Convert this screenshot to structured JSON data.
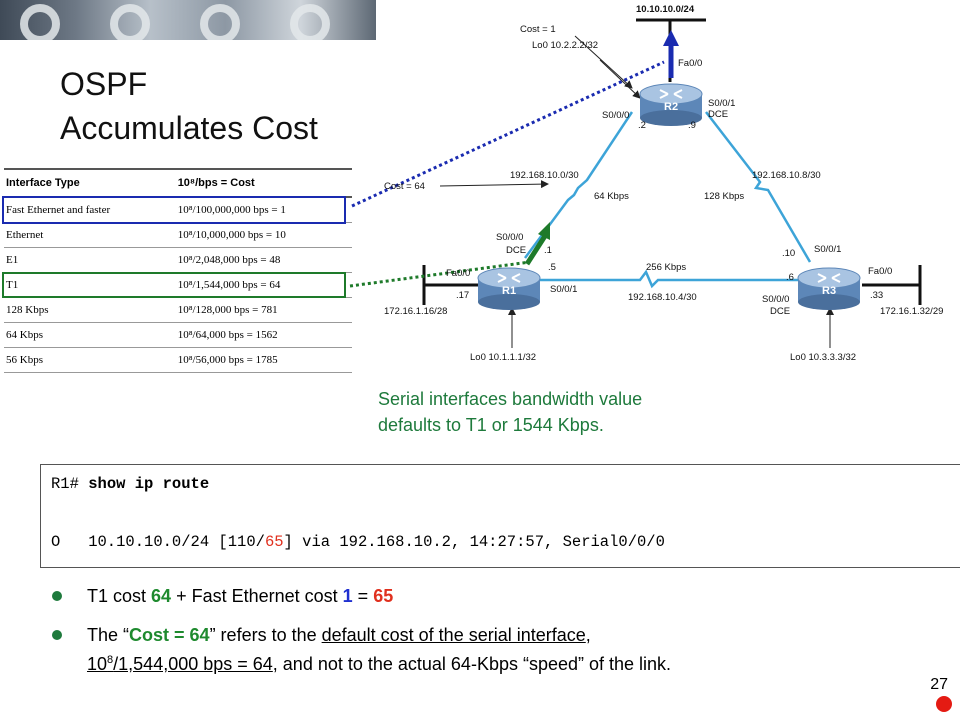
{
  "slide": {
    "title_line1": "OSPF",
    "title_line2": "Accumulates Cost",
    "page_number": "27"
  },
  "table": {
    "headers": [
      "Interface Type",
      "10⁸/bps = Cost"
    ],
    "rows": [
      [
        "Fast Ethernet and faster",
        "10⁸/100,000,000 bps = 1"
      ],
      [
        "Ethernet",
        "10⁸/10,000,000 bps = 10"
      ],
      [
        "E1",
        "10⁸/2,048,000 bps = 48"
      ],
      [
        "T1",
        "10⁸/1,544,000 bps = 64"
      ],
      [
        "128 Kbps",
        "10⁸/128,000 bps = 781"
      ],
      [
        "64 Kbps",
        "10⁸/64,000 bps = 1562"
      ],
      [
        "56 Kbps",
        "10⁸/56,000 bps = 1785"
      ]
    ],
    "highlight_colors": {
      "fast_ethernet_row": "#1a2bb0",
      "t1_row": "#1e7a2a"
    }
  },
  "topology": {
    "network_top": "10.10.10.0/24",
    "cost_1": "Cost = 1",
    "cost_64": "Cost = 64",
    "r2": {
      "name": "R2",
      "lo0": "Lo0 10.2.2.2/32",
      "fa": "Fa0/0",
      "s000": "S0/0/0",
      "s001": "S0/0/1",
      "dce": "DCE",
      "ip_left": ".2",
      "ip_right": ".9"
    },
    "r1": {
      "name": "R1",
      "lo0": "Lo0 10.1.1.1/32",
      "fa": "Fa0/0",
      "s000": "S0/0/0",
      "dce": "DCE",
      "ip_dce": ".1",
      "s001": "S0/0/1",
      "ip_s001": ".5",
      "ip_fa": ".17",
      "lan": "172.16.1.16/28"
    },
    "r3": {
      "name": "R3",
      "lo0": "Lo0 10.3.3.3/32",
      "fa": "Fa0/0",
      "s001": "S0/0/1",
      "ip_s001": ".10",
      "ip_s000": ".6",
      "s000": "S0/0/0",
      "dce": "DCE",
      "ip_fa": ".33",
      "lan": "172.16.1.32/29"
    },
    "link_r1_r2": {
      "net": "192.168.10.0/30",
      "bw": "64 Kbps"
    },
    "link_r2_r3": {
      "net": "192.168.10.8/30",
      "bw": "128 Kbps"
    },
    "link_r1_r3": {
      "net": "192.168.10.4/30",
      "bw": "256 Kbps"
    }
  },
  "note": {
    "line1": "Serial interfaces bandwidth value",
    "line2": "defaults to T1 or 1544 Kbps."
  },
  "code": {
    "prompt": "R1#",
    "command": "show ip route",
    "route_prefix": "O   10.10.10.0/24 [110/",
    "route_metric": "65",
    "route_suffix": "] via 192.168.10.2, 14:27:57, Serial0/0/0"
  },
  "bullets": {
    "b1_pre": "T1 cost ",
    "b1_t1": "64",
    "b1_mid": " + Fast Ethernet cost ",
    "b1_fe": "1",
    "b1_eq": " = ",
    "b1_total": "65",
    "b2_open": "The “",
    "b2_cost": "Cost = 64",
    "b2_mid": "” refers to the ",
    "b2_underlined": "default cost of the serial interface",
    "b2_comma": ",",
    "b2_l2_base": "10",
    "b2_l2_exp": "8",
    "b2_l2_rest": "/1,544,000 bps = 64",
    "b2_l2_tail": ", and not to the actual 64-Kbps “speed” of the link."
  }
}
